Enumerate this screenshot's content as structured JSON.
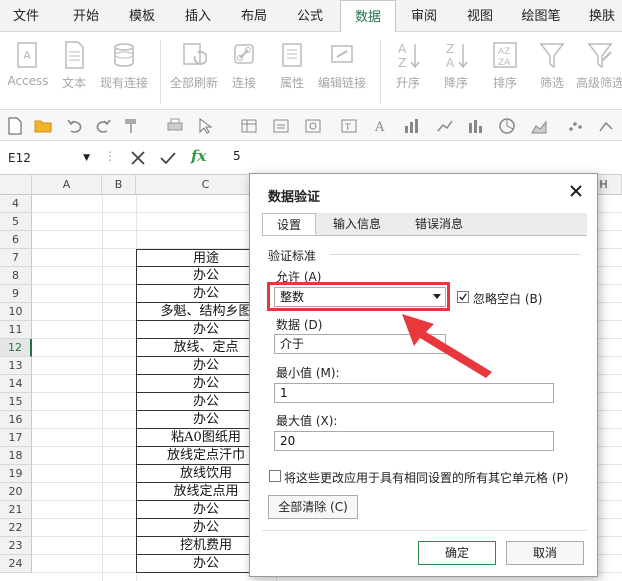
{
  "ribbon_tabs": [
    {
      "label": "文件",
      "active": false
    },
    {
      "label": "开始",
      "active": false
    },
    {
      "label": "模板",
      "active": false
    },
    {
      "label": "插入",
      "active": false
    },
    {
      "label": "布局",
      "active": false
    },
    {
      "label": "公式",
      "active": false
    },
    {
      "label": "数据",
      "active": true
    },
    {
      "label": "审阅",
      "active": false
    },
    {
      "label": "视图",
      "active": false
    },
    {
      "label": "绘图笔",
      "active": false
    },
    {
      "label": "换肤",
      "active": false
    }
  ],
  "ribbon_buttons": [
    {
      "label": "Access",
      "icon": "access-db-icon"
    },
    {
      "label": "文本",
      "icon": "text-file-icon"
    },
    {
      "label": "现有连接",
      "icon": "existing-connection-icon"
    },
    {
      "label": "全部刷新",
      "icon": "refresh-all-icon"
    },
    {
      "label": "连接",
      "icon": "connection-link-icon"
    },
    {
      "label": "属性",
      "icon": "properties-icon"
    },
    {
      "label": "编辑链接",
      "icon": "edit-link-icon"
    },
    {
      "label": "升序",
      "icon": "sort-asc-icon"
    },
    {
      "label": "降序",
      "icon": "sort-desc-icon"
    },
    {
      "label": "排序",
      "icon": "sort-icon"
    },
    {
      "label": "筛选",
      "icon": "filter-icon"
    },
    {
      "label": "高级筛选",
      "icon": "advanced-filter-icon"
    }
  ],
  "formula_bar": {
    "name_box": "E12",
    "fx_label": "fx",
    "value": "5"
  },
  "columns": [
    "A",
    "B",
    "C",
    "H"
  ],
  "rows": [
    "4",
    "5",
    "6",
    "7",
    "8",
    "9",
    "10",
    "11",
    "12",
    "13",
    "14",
    "15",
    "16",
    "17",
    "18",
    "19",
    "20",
    "21",
    "22",
    "23",
    "24"
  ],
  "selected_row": "12",
  "column_c_cells": [
    {
      "row": "7",
      "text": "用途"
    },
    {
      "row": "8",
      "text": "办公"
    },
    {
      "row": "9",
      "text": "办公"
    },
    {
      "row": "10",
      "text": "多魁、结构乡图"
    },
    {
      "row": "11",
      "text": "办公"
    },
    {
      "row": "12",
      "text": "放线、定点"
    },
    {
      "row": "13",
      "text": "办公"
    },
    {
      "row": "14",
      "text": "办公"
    },
    {
      "row": "15",
      "text": "办公"
    },
    {
      "row": "16",
      "text": "办公"
    },
    {
      "row": "17",
      "text": "粘A0图纸用"
    },
    {
      "row": "18",
      "text": "放线定点汗巾"
    },
    {
      "row": "19",
      "text": "放线饮用"
    },
    {
      "row": "20",
      "text": "放线定点用"
    },
    {
      "row": "21",
      "text": "办公"
    },
    {
      "row": "22",
      "text": "办公"
    },
    {
      "row": "23",
      "text": "挖机费用"
    },
    {
      "row": "24",
      "text": "办公"
    }
  ],
  "dialog": {
    "title": "数据验证",
    "tabs": [
      {
        "label": "设置",
        "active": true
      },
      {
        "label": "输入信息",
        "active": false
      },
      {
        "label": "错误消息",
        "active": false
      }
    ],
    "section_label": "验证标准",
    "allow_label": "允许 (A)",
    "allow_value": "整数",
    "ignore_blank_label": "忽略空白 (B)",
    "ignore_blank_checked": true,
    "data_label": "数据 (D)",
    "data_value": "介于",
    "min_label": "最小值 (M):",
    "min_value": "1",
    "max_label": "最大值 (X):",
    "max_value": "20",
    "apply_all_label": "将这些更改应用于具有相同设置的所有其它单元格 (P)",
    "apply_all_checked": false,
    "clear_all_label": "全部清除 (C)",
    "ok_label": "确定",
    "cancel_label": "取消"
  },
  "colors": {
    "accent": "#217346",
    "highlight": "#e8383d"
  }
}
